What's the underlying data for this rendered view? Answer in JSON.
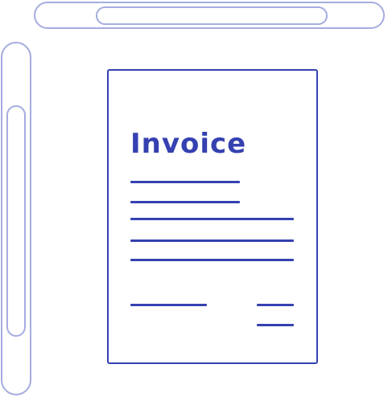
{
  "colors": {
    "scrollbar": "#a5acdf",
    "document": "#3541b0"
  },
  "document": {
    "title": "Invoice",
    "icon": "invoice-document-icon"
  }
}
